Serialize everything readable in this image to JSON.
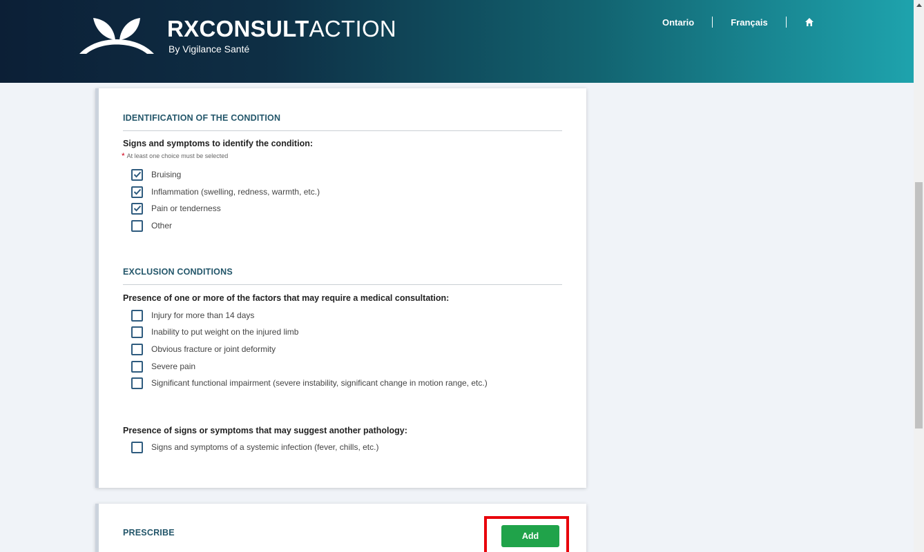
{
  "header": {
    "brand_bold": "RXCONSULT",
    "brand_light": "ACTION",
    "byline": "By Vigilance Santé",
    "nav": {
      "province": "Ontario",
      "language": "Français",
      "home_icon": "home-icon"
    },
    "gradient": [
      "#0c1f36",
      "#1ea3ad"
    ]
  },
  "identification": {
    "title": "IDENTIFICATION OF THE CONDITION",
    "question": "Signs and symptoms to identify the condition:",
    "required_marker": "*",
    "hint": "At least one choice must be selected",
    "options": [
      {
        "label": "Bruising",
        "checked": true
      },
      {
        "label": "Inflammation (swelling, redness, warmth, etc.)",
        "checked": true
      },
      {
        "label": "Pain or tenderness",
        "checked": true
      },
      {
        "label": "Other",
        "checked": false
      }
    ]
  },
  "exclusion": {
    "title": "EXCLUSION CONDITIONS",
    "question1": "Presence of one or more of the factors that may require a medical consultation:",
    "options1": [
      {
        "label": "Injury for more than 14 days",
        "checked": false
      },
      {
        "label": "Inability to put weight on the injured limb",
        "checked": false
      },
      {
        "label": "Obvious fracture or joint deformity",
        "checked": false
      },
      {
        "label": "Severe pain",
        "checked": false
      },
      {
        "label": "Significant functional impairment (severe instability, significant change in motion range, etc.)",
        "checked": false
      }
    ],
    "question2": "Presence of signs or symptoms that may suggest another pathology:",
    "options2": [
      {
        "label": "Signs and symptoms of a systemic infection (fever, chills, etc.)",
        "checked": false
      }
    ]
  },
  "prescribe": {
    "title": "PRESCRIBE",
    "add_label": "Add",
    "add_color": "#20a34a",
    "highlight_color": "#e8000a"
  }
}
